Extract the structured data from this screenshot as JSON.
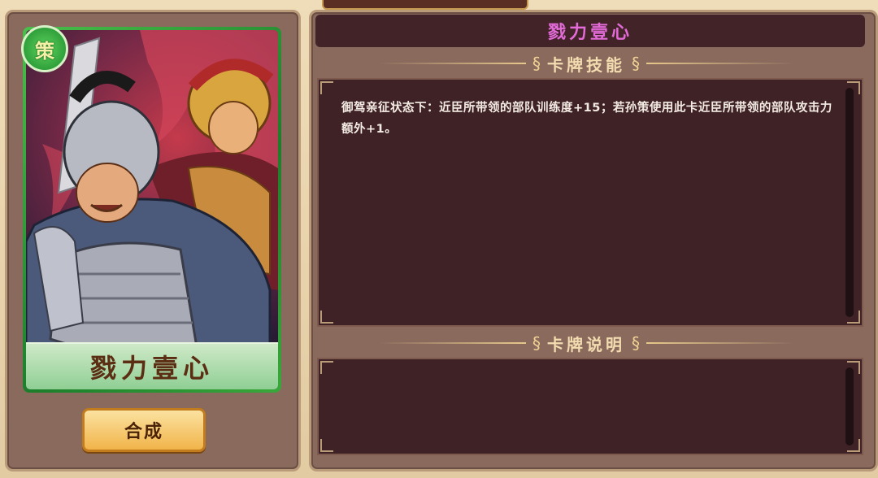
{
  "card": {
    "name": "戮力壹心",
    "badge": "策",
    "colors": {
      "frame": "#2e9f3a",
      "name": "#5b2d12"
    }
  },
  "actions": {
    "combine_label": "合成"
  },
  "detail": {
    "title": "戮力壹心",
    "title_color": "#e26bd8",
    "skill_header": "卡牌技能",
    "skill_text": "御驾亲征状态下：近臣所带领的部队训练度+15；若孙策使用此卡近臣所带领的部队攻击力额外+1。",
    "desc_header": "卡牌说明",
    "desc_text": ""
  },
  "icons": {
    "header_ornament": "swirl-ornament-icon",
    "badge": "faction-badge-icon"
  }
}
